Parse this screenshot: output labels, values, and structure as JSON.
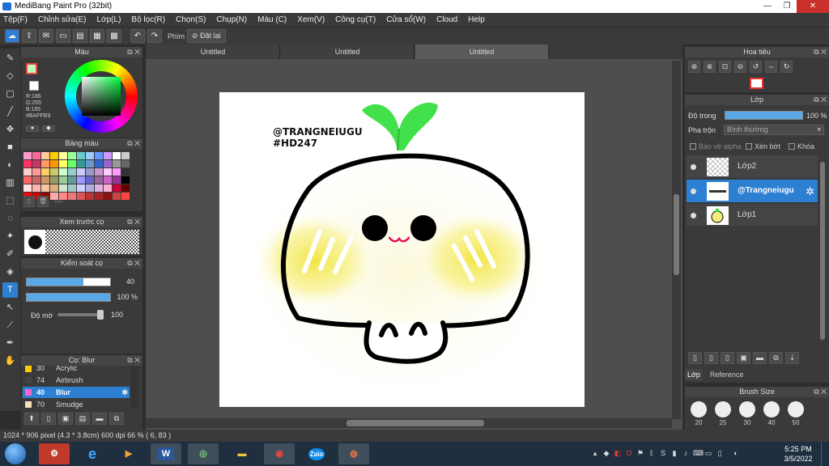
{
  "window": {
    "title": "MediBang Paint Pro (32bit)",
    "min": "—",
    "max": "❐",
    "close": "✕"
  },
  "menu": [
    "Tệp(F)",
    "Chỉnh sửa(E)",
    "Lớp(L)",
    "Bộ lọc(R)",
    "Chọn(S)",
    "Chụp(N)",
    "Màu (C)",
    "Xem(V)",
    "Công cụ(T)",
    "Cửa sổ(W)",
    "Cloud",
    "Help"
  ],
  "toolbar": {
    "phim_label": "Phím",
    "reset_label": "Đặt lại"
  },
  "color_panel": {
    "title": "Màu",
    "fg_color": "#BAFFB9",
    "rgb_text": "R:186\nG:255\nB:185\n#BAFFB9"
  },
  "swatch_panel": {
    "title": "Bảng màu",
    "footer_text": "---",
    "colors": [
      "#ff99cc",
      "#ff6699",
      "#ffcc99",
      "#ffcc00",
      "#ffff99",
      "#99ff99",
      "#66cccc",
      "#99ccff",
      "#6699ff",
      "#cc99ff",
      "#ffffff",
      "#cccccc",
      "#ff3366",
      "#cc3366",
      "#ff9966",
      "#ff9900",
      "#ffff66",
      "#66ff66",
      "#339999",
      "#6699cc",
      "#3366cc",
      "#9966cc",
      "#999999",
      "#666666",
      "#ffcccc",
      "#ff9999",
      "#ffcc66",
      "#cccc66",
      "#ccffcc",
      "#99cccc",
      "#ccccff",
      "#9999cc",
      "#cc99cc",
      "#ffccff",
      "#ff99ff",
      "#333333",
      "#ff6666",
      "#cc6666",
      "#cc9966",
      "#999966",
      "#99cc99",
      "#669999",
      "#9999ff",
      "#6666cc",
      "#996699",
      "#cc66cc",
      "#993399",
      "#000000",
      "#ffe0e0",
      "#ffb3b3",
      "#f2c6a0",
      "#e0b080",
      "#d0e8d0",
      "#a0c8c8",
      "#d0d0ff",
      "#b0b0e0",
      "#e0b0e0",
      "#ffb0d0",
      "#cc0033",
      "#660000",
      "#ff0000",
      "#cc0000",
      "#990000",
      "#ffaaaa",
      "#ff8888",
      "#ee7777",
      "#dd5555",
      "#bb3333",
      "#aa2222",
      "#881111",
      "#cc4444",
      "#ff4444"
    ]
  },
  "preview_panel": {
    "title": "Xem trước cọ"
  },
  "control_panel": {
    "title": "Kiểm soát cọ",
    "size_value": "40",
    "size_fill": 0.68,
    "alpha_value": "100 %",
    "alpha_fill": 1.0,
    "opacity_label": "Độ mờ",
    "opacity_value": "100"
  },
  "brush_panel": {
    "title": "Cọ: Blur",
    "items": [
      {
        "num": "30",
        "name": "Acrylic",
        "color": "#ffcc00"
      },
      {
        "num": "74",
        "name": "Airbrush",
        "color": "#444444"
      },
      {
        "num": "40",
        "name": "Blur",
        "color": "#ff66cc"
      },
      {
        "num": "70",
        "name": "Smudge",
        "color": "#f5e0c0"
      }
    ]
  },
  "tabs": [
    "Untitled",
    "Untitled",
    "Untitled"
  ],
  "artwork": {
    "line1": "@TRANGNEIUGU",
    "line2": "#HD247"
  },
  "navigator": {
    "title": "Hoa tiêu"
  },
  "layer_panel": {
    "title": "Lớp",
    "opacity_label": "Độ trong",
    "opacity_value": "100 %",
    "blend_label": "Pha trộn",
    "blend_value": "Bình thường",
    "protect_alpha": "Bảo vệ alpha",
    "clipping": "Xén bớt",
    "lock": "Khóa",
    "layers": [
      {
        "name": "Lớp2"
      },
      {
        "name": "@Trangneiugu"
      },
      {
        "name": "Lớp1"
      }
    ],
    "tab_layer": "Lớp",
    "tab_reference": "Reference"
  },
  "brush_size_panel": {
    "title": "Brush Size",
    "sizes": [
      "20",
      "25",
      "30",
      "40",
      "50"
    ]
  },
  "status": {
    "text": "1024 * 906 pixel  (4.3 * 3.8cm)  600 dpi  66 %  ( 6, 83 )"
  },
  "taskbar": {
    "time": "5:25 PM",
    "date": "3/5/2022",
    "word_label": "W",
    "zalo_label": "Zalo"
  }
}
